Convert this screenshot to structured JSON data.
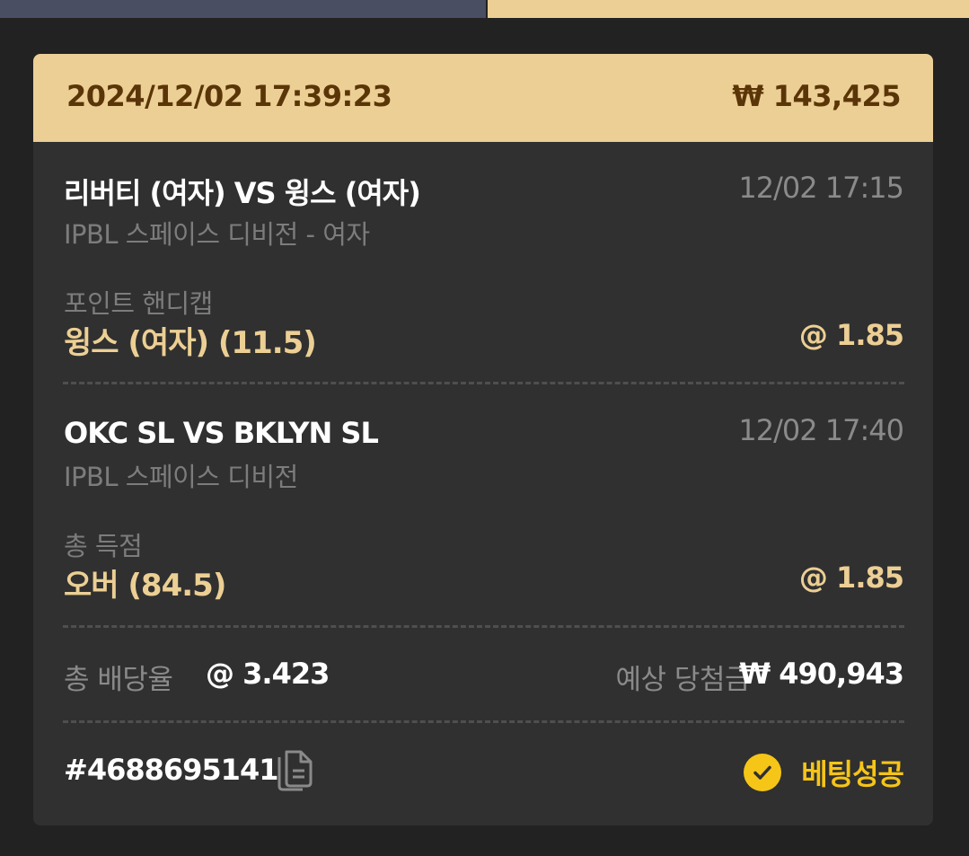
{
  "bet": {
    "placed_at": "2024/12/02 17:39:23",
    "amount": "₩ 143,425",
    "selections": [
      {
        "match": "리버티 (여자) VS 윙스 (여자)",
        "start_time": "12/02 17:15",
        "league": "IPBL 스페이스 디비전 - 여자",
        "market": "포인트 핸디캡",
        "pick": "윙스 (여자) (11.5)",
        "odds": "@ 1.85"
      },
      {
        "match": "OKC SL VS BKLYN SL",
        "start_time": "12/02 17:40",
        "league": "IPBL 스페이스 디비전",
        "market": "총 득점",
        "pick": "오버 (84.5)",
        "odds": "@ 1.85"
      }
    ],
    "total_odds_label": "총 배당율",
    "total_odds": "@ 3.423",
    "expected_win_label": "예상 당첨금",
    "expected_win": "₩ 490,943",
    "ticket_id": "#4688695141",
    "status": "베팅성공"
  },
  "icons": {
    "copy": "copy-icon",
    "status": "check-circle-icon"
  },
  "colors": {
    "header_bg": "#eccf94",
    "header_text": "#5a3508",
    "card_bg": "#303030",
    "page_bg": "#222222",
    "accent": "#eccf94",
    "success": "#f5c518",
    "tab_left": "#4a4e63"
  }
}
